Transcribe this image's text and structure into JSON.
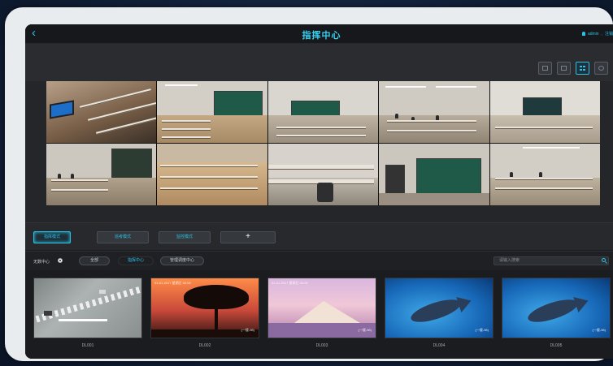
{
  "header": {
    "back_icon": "chevron-left-icon",
    "title": "指挥中心",
    "user_icon": "user-icon",
    "user": "admin",
    "logout": "注销"
  },
  "toolbar": {
    "buttons": [
      {
        "icon": "layout-single-icon"
      },
      {
        "icon": "layout-split-icon"
      },
      {
        "icon": "layout-grid-icon"
      },
      {
        "icon": "fullscreen-icon"
      }
    ],
    "active_index": 2
  },
  "modes": {
    "buttons": [
      "指挥模式",
      "巡考模式",
      "监控模式"
    ],
    "add_label": "+",
    "active_index": 0
  },
  "filter": {
    "label": "无数中心",
    "options": [
      "全部",
      "指挥中心",
      "管理调度中心"
    ],
    "active_index": 1,
    "search_placeholder": "请输入搜索"
  },
  "thumbnails": [
    {
      "caption": "DL001",
      "meta": "",
      "badge": ""
    },
    {
      "caption": "DL002",
      "meta": "01-01-2017 星期日 00:00",
      "badge": "(一楼-98)"
    },
    {
      "caption": "DL003",
      "meta": "01-01-2017 星期日 00:00",
      "badge": "(一楼-98)"
    },
    {
      "caption": "DL004",
      "meta": "",
      "badge": "(一楼-98)"
    },
    {
      "caption": "DL005",
      "meta": "",
      "badge": "(一楼-98)"
    }
  ],
  "colors": {
    "accent": "#29c3e8",
    "background": "#1a1c20",
    "frame": "#e9ecef"
  }
}
